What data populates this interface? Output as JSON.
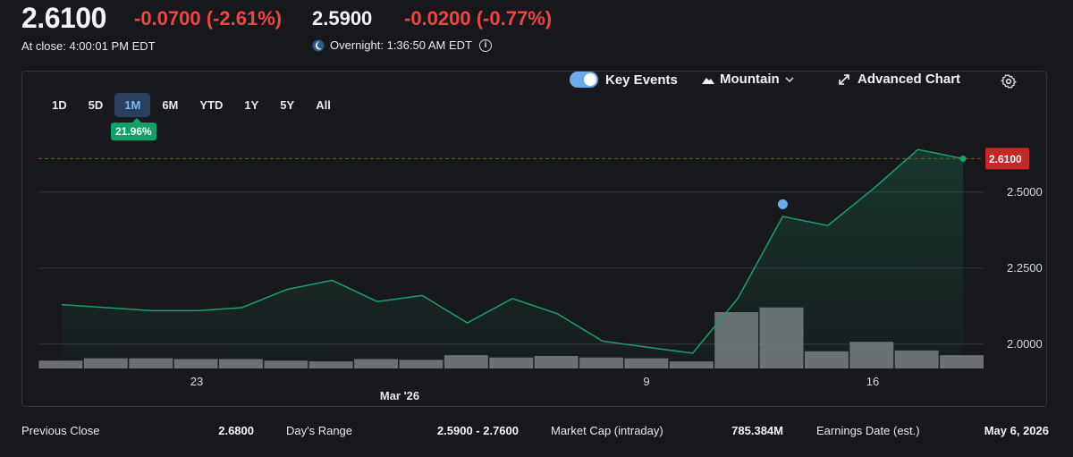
{
  "quote": {
    "price": "2.6100",
    "change": "-0.0700 (-2.61%)",
    "overnight_price": "2.5900",
    "overnight_change": "-0.0200 (-0.77%)",
    "close_time": "At close: 4:00:01 PM EDT",
    "overnight_time": "Overnight: 1:36:50 AM EDT"
  },
  "chart_controls": {
    "ranges": [
      "1D",
      "5D",
      "1M",
      "6M",
      "YTD",
      "1Y",
      "5Y",
      "All"
    ],
    "active_range": "1M",
    "range_change_badge": "21.96%",
    "key_events_label": "Key Events",
    "key_events_on": true,
    "chart_type_label": "Mountain",
    "advanced_chart_label": "Advanced Chart"
  },
  "colors": {
    "up": "#10a06a",
    "down": "#ef4444",
    "accent": "#6da9ef",
    "line": "#1f9d6b",
    "volume": "#7c7f83"
  },
  "chart_data": {
    "type": "area",
    "y_tick_labels": [
      "2.5000",
      "2.2500",
      "2.0000"
    ],
    "y_ticks": [
      2.5,
      2.25,
      2.0
    ],
    "ylim": [
      1.92,
      2.72
    ],
    "x_tick_labels": [
      "23",
      "9",
      "16"
    ],
    "x_sublabel": "Mar '26",
    "last_price_label": "2.6100",
    "last_price": 2.61,
    "series": [
      {
        "values": [
          2.13,
          2.12,
          2.11,
          2.11,
          2.12,
          2.18,
          2.21,
          2.14,
          2.16,
          2.07,
          2.15,
          2.1,
          2.01,
          1.99,
          1.97,
          2.15,
          2.42,
          2.39,
          2.51,
          2.64,
          2.61
        ]
      }
    ],
    "volume": [
      10,
      13,
      13,
      12,
      12,
      10,
      9,
      12,
      11,
      17,
      14,
      16,
      14,
      13,
      9,
      72,
      78,
      22,
      34,
      23,
      17
    ],
    "key_event_index": 16,
    "key_event_value": 2.46
  },
  "stats": [
    {
      "label": "Previous Close",
      "value": "2.6800"
    },
    {
      "label": "Day's Range",
      "value": "2.5900 - 2.7600"
    },
    {
      "label": "Market Cap (intraday)",
      "value": "785.384M"
    },
    {
      "label": "Earnings Date (est.)",
      "value": "May 6, 2026"
    }
  ]
}
